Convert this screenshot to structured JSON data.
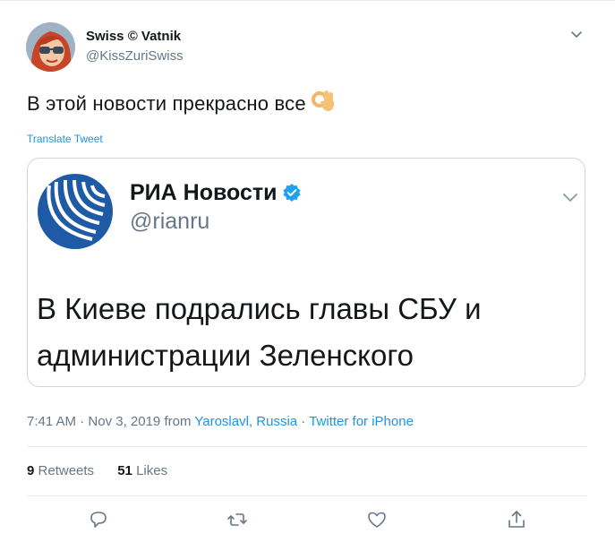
{
  "author": {
    "display_name": "Swiss © Vatnik",
    "handle": "@KissZuriSwiss"
  },
  "tweet": {
    "text": "В этой новости прекрасно все",
    "emoji": "ok-hand-icon",
    "translate_label": "Translate Tweet"
  },
  "quoted": {
    "name": "РИА Новости",
    "handle": "@rianru",
    "text": "В Киеве подрались главы СБУ и администрации Зеленского"
  },
  "meta": {
    "time": "7:41 AM",
    "sep1": " · ",
    "date": "Nov 3, 2019",
    "from": " from ",
    "location": "Yaroslavl, Russia",
    "sep2": " · ",
    "source": "Twitter for iPhone"
  },
  "stats": {
    "retweets_count": "9",
    "retweets_label": "Retweets",
    "likes_count": "51",
    "likes_label": "Likes"
  },
  "colors": {
    "link_blue": "#1b95e0",
    "muted_text": "#657786",
    "ria_blue": "#1f5aa6"
  }
}
